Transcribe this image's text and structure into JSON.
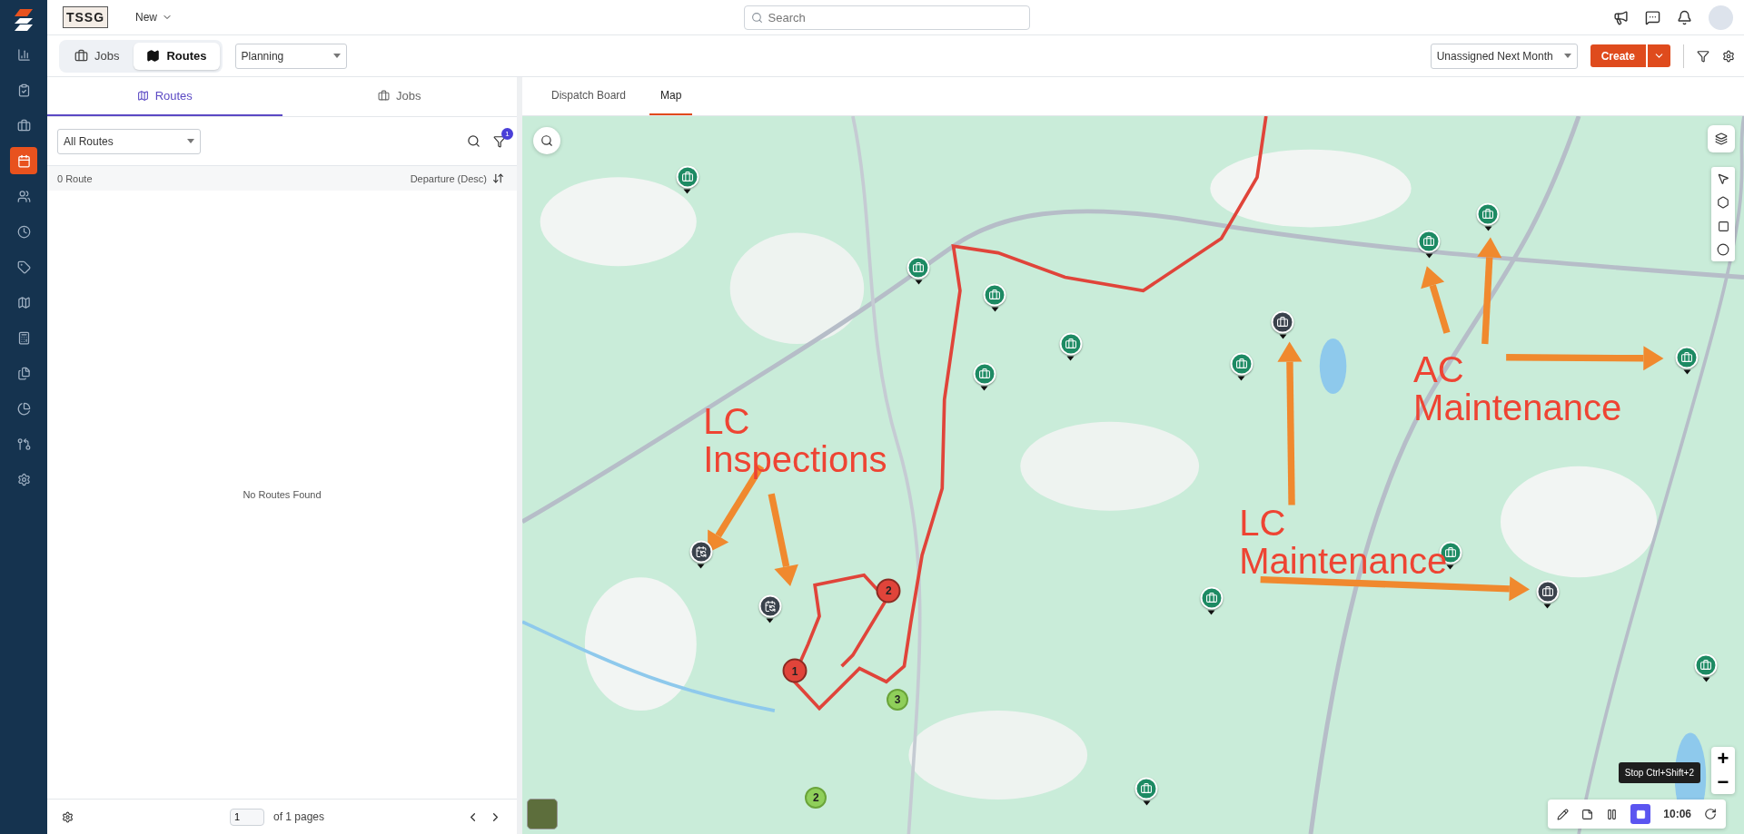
{
  "header": {
    "logo_text": "TSSG",
    "new_menu": "New",
    "search": {
      "placeholder": "Search"
    }
  },
  "sidebar": {
    "items": [
      {
        "selected": false
      },
      {
        "selected": false
      },
      {
        "selected": false
      },
      {
        "selected": true
      },
      {
        "selected": false
      },
      {
        "selected": false
      },
      {
        "selected": false
      },
      {
        "selected": false
      },
      {
        "selected": false
      },
      {
        "selected": false
      },
      {
        "selected": false
      },
      {
        "selected": false
      },
      {
        "selected": false
      }
    ]
  },
  "toolbar": {
    "view_toggle": [
      {
        "label": "Jobs",
        "selected": false
      },
      {
        "label": "Routes",
        "selected": true
      }
    ],
    "mode_select": "Planning",
    "period_select": "Unassigned Next Month",
    "create_button": "Create"
  },
  "left_panel": {
    "tabs": [
      {
        "label": "Routes",
        "selected": true
      },
      {
        "label": "Jobs",
        "selected": false
      }
    ],
    "route_filter": "All Routes",
    "filter_badge": "1",
    "count": "0 Route",
    "sort": "Departure (Desc)",
    "empty_message": "No Routes Found",
    "pager": {
      "page": "1",
      "of_pages": "of 1 pages"
    }
  },
  "map_panel": {
    "tabs": [
      {
        "label": "Dispatch Board",
        "selected": false
      },
      {
        "label": "Map",
        "selected": true
      }
    ],
    "markers": [
      {
        "kind": "job"
      },
      {
        "kind": "job"
      },
      {
        "kind": "job"
      },
      {
        "kind": "job"
      },
      {
        "kind": "job"
      },
      {
        "kind": "job"
      },
      {
        "kind": "job"
      },
      {
        "kind": "job"
      },
      {
        "kind": "job"
      },
      {
        "kind": "job"
      },
      {
        "kind": "job"
      },
      {
        "kind": "job"
      },
      {
        "kind": "job"
      },
      {
        "kind": "unassigned"
      },
      {
        "kind": "unassigned"
      },
      {
        "kind": "recurring"
      },
      {
        "kind": "recurring"
      },
      {
        "kind": "stop",
        "label": "1",
        "color": "#e0443a"
      },
      {
        "kind": "stop",
        "label": "2",
        "color": "#e0443a"
      },
      {
        "kind": "stop",
        "label": "3",
        "color": "#8fcf5a"
      },
      {
        "kind": "stop",
        "label": "2",
        "color": "#8fcf5a"
      }
    ],
    "annotations": [
      {
        "lines": [
          "LC",
          "Inspections"
        ]
      },
      {
        "lines": [
          "AC",
          "Maintenance"
        ]
      },
      {
        "lines": [
          "LC",
          "Maintenance"
        ]
      }
    ],
    "zoom_in": "+",
    "zoom_out": "−",
    "recorder": {
      "tooltip": "Stop Ctrl+Shift+2",
      "time": "10:06"
    }
  }
}
